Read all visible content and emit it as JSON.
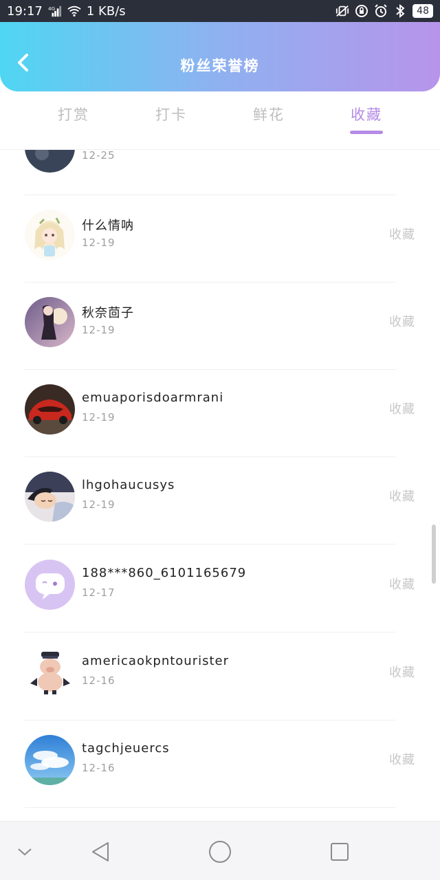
{
  "status_bar": {
    "time": "19:17",
    "network_tag": "4G",
    "speed": "1 KB/s",
    "battery": "48"
  },
  "header": {
    "title": "粉丝荣誉榜"
  },
  "tabs": [
    {
      "label": "打赏",
      "active": false
    },
    {
      "label": "打卡",
      "active": false
    },
    {
      "label": "鲜花",
      "active": false
    },
    {
      "label": "收藏",
      "active": true
    }
  ],
  "list": {
    "partial_top": {
      "date": "12-25"
    },
    "items": [
      {
        "name": "什么情呐",
        "date": "12-19",
        "action": "收藏",
        "avatar": "anime-girl-avatar"
      },
      {
        "name": "秋奈茴子",
        "date": "12-19",
        "action": "收藏",
        "avatar": "night-girl-avatar"
      },
      {
        "name": "emuaporisdoarmrani",
        "date": "12-19",
        "action": "收藏",
        "avatar": "red-car-avatar"
      },
      {
        "name": "lhgohaucusys",
        "date": "12-19",
        "action": "收藏",
        "avatar": "sleeping-boy-avatar"
      },
      {
        "name": "188***860_6101165679",
        "date": "12-17",
        "action": "收藏",
        "avatar": "default-chat-avatar"
      },
      {
        "name": "americaokpntourister",
        "date": "12-16",
        "action": "收藏",
        "avatar": "cartoon-pig-avatar"
      },
      {
        "name": "tagchjeuercs",
        "date": "12-16",
        "action": "收藏",
        "avatar": "sky-clouds-avatar"
      }
    ]
  },
  "colors": {
    "accent": "#b48be6",
    "header_start": "#4fd6f2",
    "header_end": "#b794ea",
    "inactive_tab": "#bdbdbd",
    "action_text": "#c7c7c7"
  }
}
